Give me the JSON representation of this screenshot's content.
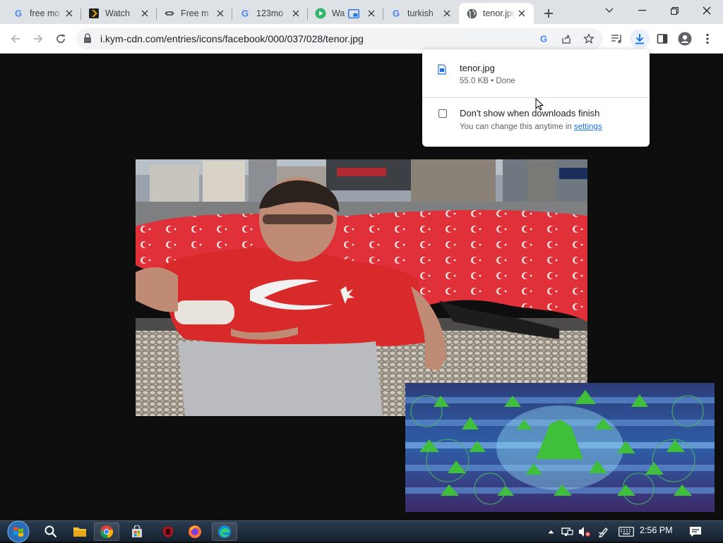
{
  "browser": {
    "tabs": [
      {
        "title": "free mo",
        "favicon": "google-g-icon"
      },
      {
        "title": "Watch",
        "favicon": "plex-icon"
      },
      {
        "title": "Free m",
        "favicon": "site-icon"
      },
      {
        "title": "123mo",
        "favicon": "google-g-icon"
      },
      {
        "title": "Wa",
        "favicon": "play-icon"
      },
      {
        "title": "turkish",
        "favicon": "google-g-icon"
      },
      {
        "title": "tenor.jpg",
        "favicon": "globe-icon",
        "active": true
      }
    ],
    "url": "i.kym-cdn.com/entries/icons/facebook/000/037/028/tenor.jpg"
  },
  "downloads": {
    "filename": "tenor.jpg",
    "status": "55.0 KB • Done",
    "checkbox_label": "Don't show when downloads finish",
    "hint_text": "You can change this anytime in",
    "hint_link": "settings"
  },
  "taskbar": {
    "time": "2:56 PM"
  },
  "colors": {
    "accent": "#1a73e8",
    "tabstrip": "#dee1e6",
    "page_background": "#0e0e0e"
  }
}
